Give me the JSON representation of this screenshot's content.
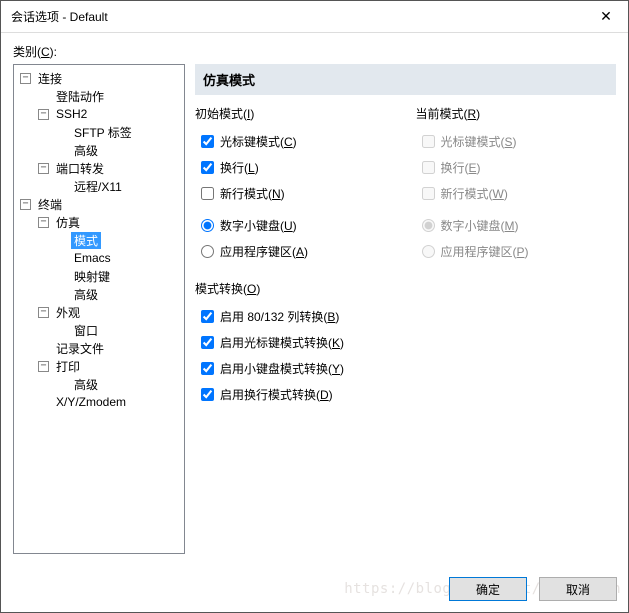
{
  "window": {
    "title": "会话选项 - Default"
  },
  "category_label": {
    "text": "类别(",
    "mn": "C",
    "after": "):"
  },
  "tree": {
    "connection": "连接",
    "logon": "登陆动作",
    "ssh2": "SSH2",
    "sftp": "SFTP 标签",
    "ssh_adv": "高级",
    "portfwd": "端口转发",
    "remote": "远程/X11",
    "terminal": "终端",
    "emulation": "仿真",
    "mode": "模式",
    "emacs": "Emacs",
    "mapkeys": "映射键",
    "term_adv": "高级",
    "appearance": "外观",
    "window": "窗口",
    "logfile": "记录文件",
    "print": "打印",
    "print_adv": "高级",
    "xyz": "X/Y/Zmodem"
  },
  "panel": {
    "heading": "仿真模式",
    "initial": {
      "label": "初始模式(",
      "mn": "I",
      "after": ")"
    },
    "current": {
      "label": "当前模式(",
      "mn": "R",
      "after": ")"
    },
    "cursor": {
      "text": "光标键模式(",
      "mn": "C",
      "after": ")"
    },
    "newline": {
      "text": "换行(",
      "mn": "L",
      "after": ")"
    },
    "newlinemode": {
      "text": "新行模式(",
      "mn": "N",
      "after": ")"
    },
    "numpad": {
      "text": "数字小键盘(",
      "mn": "U",
      "after": ")"
    },
    "appkeypad": {
      "text": "应用程序键区(",
      "mn": "A",
      "after": ")"
    },
    "cursor_r": {
      "text": "光标键模式(",
      "mn": "S",
      "after": ")"
    },
    "newline_r": {
      "text": "换行(",
      "mn": "E",
      "after": ")"
    },
    "newlinemode_r": {
      "text": "新行模式(",
      "mn": "W",
      "after": ")"
    },
    "numpad_r": {
      "text": "数字小键盘(",
      "mn": "M",
      "after": ")"
    },
    "appkeypad_r": {
      "text": "应用程序键区(",
      "mn": "P",
      "after": ")"
    },
    "switch_label": {
      "text": "模式转换(",
      "mn": "O",
      "after": ")"
    },
    "sw1": {
      "text": "启用 80/132 列转换(",
      "mn": "B",
      "after": ")"
    },
    "sw2": {
      "text": "启用光标键模式转换(",
      "mn": "K",
      "after": ")"
    },
    "sw3": {
      "text": "启用小键盘模式转换(",
      "mn": "Y",
      "after": ")"
    },
    "sw4": {
      "text": "启用换行模式转换(",
      "mn": "D",
      "after": ")"
    }
  },
  "buttons": {
    "ok": "确定",
    "cancel": "取消"
  },
  "watermark": "https://blog.csdn.net/yuanxiiwn"
}
